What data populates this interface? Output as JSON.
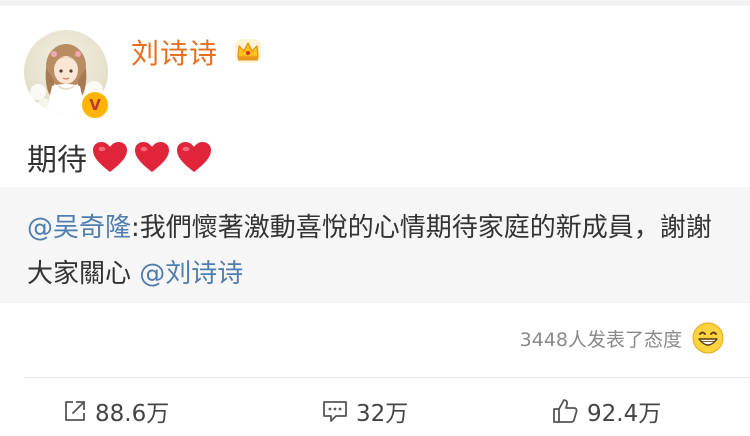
{
  "user": {
    "name": "刘诗诗",
    "verified_badge": "V"
  },
  "post": {
    "text": "期待",
    "hearts": 3
  },
  "repost": {
    "mention_author": "@吴奇隆",
    "body": ":我們懷著激動喜悅的心情期待家庭的新成員，謝謝大家關心 ",
    "mention_user": "@刘诗诗"
  },
  "attitude": {
    "text": "3448人发表了态度"
  },
  "actions": {
    "repost_count": "88.6万",
    "comment_count": "32万",
    "like_count": "92.4万"
  },
  "colors": {
    "username": "#e86f1f",
    "mention": "#507daf",
    "heart": "#e0243a",
    "repost_bg": "#f6f6f6"
  },
  "icons": [
    "crown-icon",
    "heart-icon",
    "verified-icon",
    "smile-icon",
    "repost-icon",
    "comment-icon",
    "like-icon"
  ]
}
